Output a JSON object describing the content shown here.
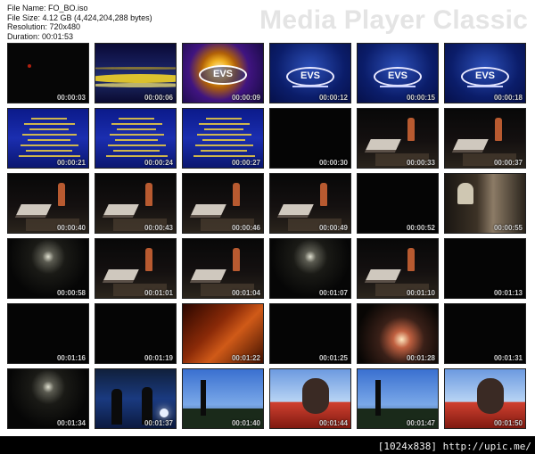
{
  "header": {
    "file_name": "File Name: FO_BO.iso",
    "file_size": "File Size: 4.12 GB (4,424,204,288 bytes)",
    "resolution": "Resolution: 720x480",
    "duration": "Duration: 00:01:53"
  },
  "brand": "Media Player Classic",
  "thumbnails": [
    {
      "time": "00:00:03",
      "scene": "red-dot"
    },
    {
      "time": "00:00:06",
      "scene": "yellow"
    },
    {
      "time": "00:00:09",
      "scene": "orb"
    },
    {
      "time": "00:00:12",
      "scene": "evs"
    },
    {
      "time": "00:00:15",
      "scene": "evs"
    },
    {
      "time": "00:00:18",
      "scene": "evs"
    },
    {
      "time": "00:00:21",
      "scene": "text"
    },
    {
      "time": "00:00:24",
      "scene": "text"
    },
    {
      "time": "00:00:27",
      "scene": "text"
    },
    {
      "time": "00:00:30",
      "scene": "dark"
    },
    {
      "time": "00:00:33",
      "scene": "room"
    },
    {
      "time": "00:00:37",
      "scene": "room"
    },
    {
      "time": "00:00:40",
      "scene": "room"
    },
    {
      "time": "00:00:43",
      "scene": "room"
    },
    {
      "time": "00:00:46",
      "scene": "room"
    },
    {
      "time": "00:00:49",
      "scene": "room"
    },
    {
      "time": "00:00:52",
      "scene": "dark"
    },
    {
      "time": "00:00:55",
      "scene": "cave"
    },
    {
      "time": "00:00:58",
      "scene": "corridor"
    },
    {
      "time": "00:01:01",
      "scene": "room"
    },
    {
      "time": "00:01:04",
      "scene": "room"
    },
    {
      "time": "00:01:07",
      "scene": "corridor"
    },
    {
      "time": "00:01:10",
      "scene": "room"
    },
    {
      "time": "00:01:13",
      "scene": "dark"
    },
    {
      "time": "00:01:16",
      "scene": "dark"
    },
    {
      "time": "00:01:19",
      "scene": "dark"
    },
    {
      "time": "00:01:22",
      "scene": "orange"
    },
    {
      "time": "00:01:25",
      "scene": "dark"
    },
    {
      "time": "00:01:28",
      "scene": "forest"
    },
    {
      "time": "00:01:31",
      "scene": "dark"
    },
    {
      "time": "00:01:34",
      "scene": "corridor"
    },
    {
      "time": "00:01:37",
      "scene": "night"
    },
    {
      "time": "00:01:40",
      "scene": "sky"
    },
    {
      "time": "00:01:44",
      "scene": "face"
    },
    {
      "time": "00:01:47",
      "scene": "sky"
    },
    {
      "time": "00:01:50",
      "scene": "face"
    }
  ],
  "footer": {
    "dimensions": "[1024x838]",
    "url": "http://upic.me/"
  }
}
